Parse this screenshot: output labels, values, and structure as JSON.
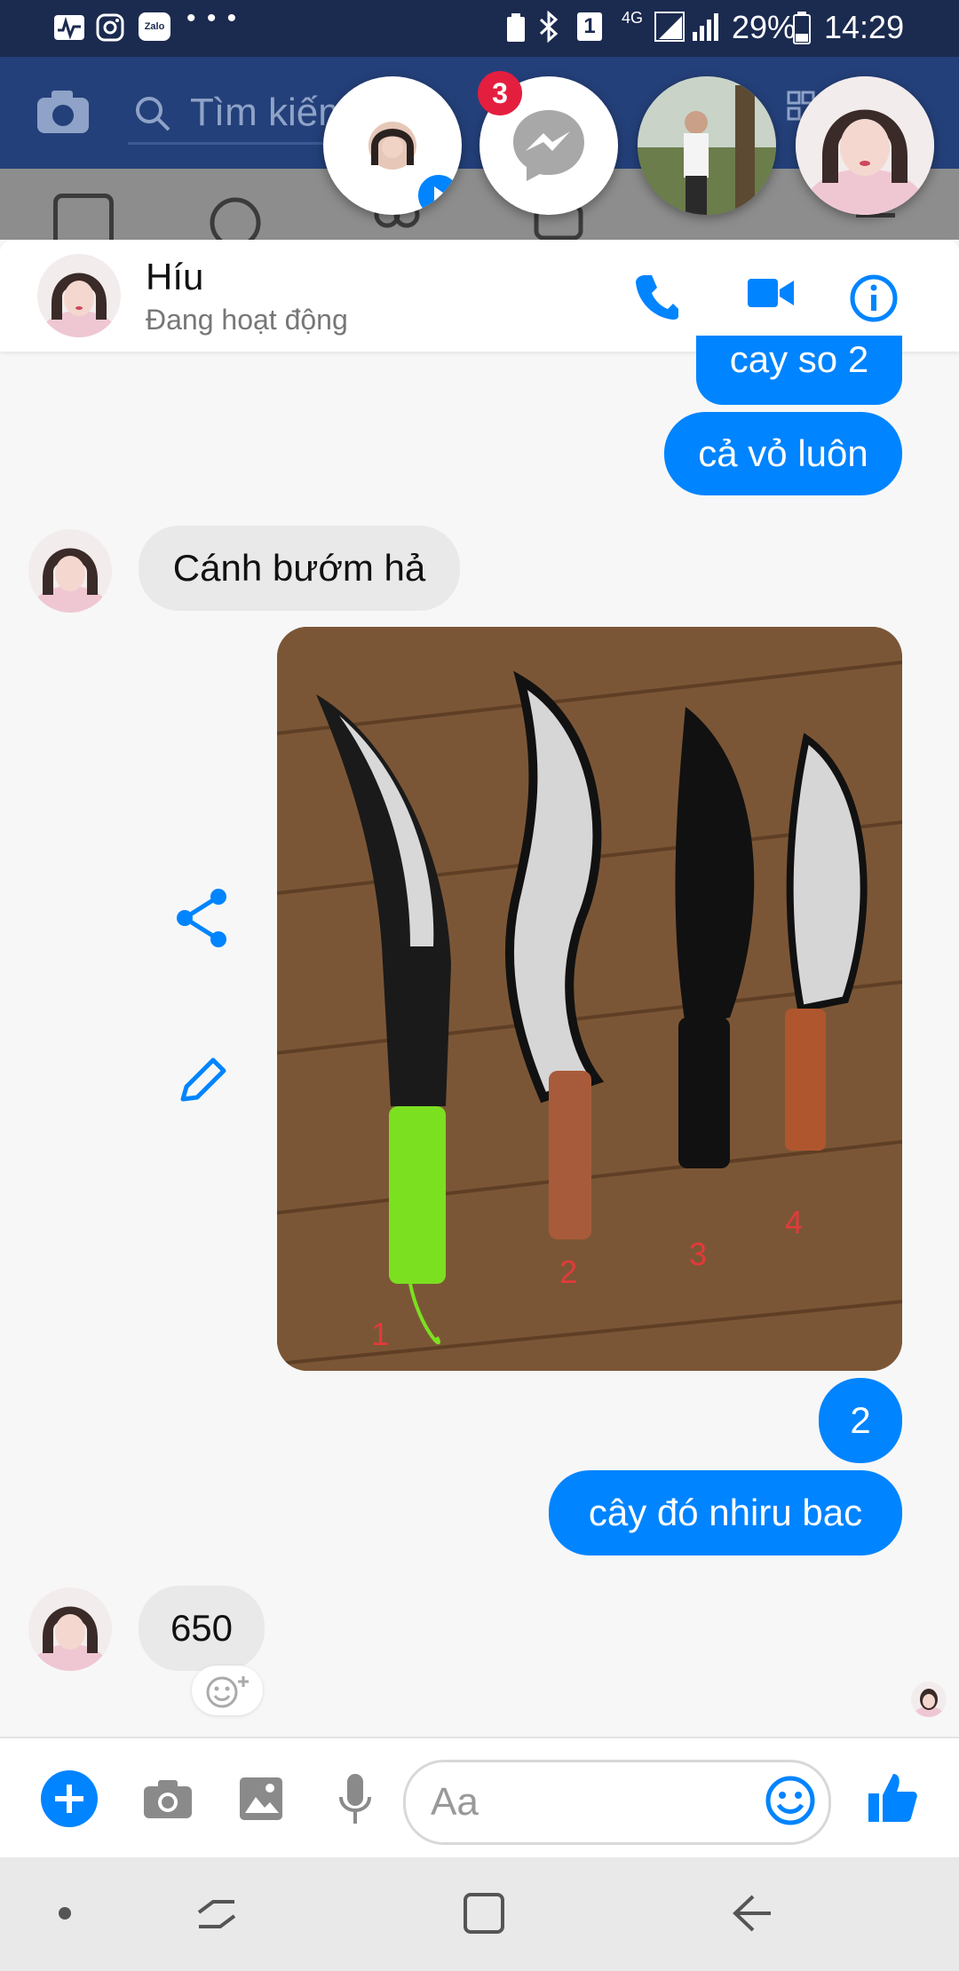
{
  "status_bar": {
    "left_icons": [
      "activity-icon",
      "instagram-icon",
      "zalo-icon"
    ],
    "zalo_text": "Zalo",
    "more": "• • •",
    "battery": "29%",
    "time": "14:29",
    "sim": "1",
    "network": "4G"
  },
  "facebook": {
    "search_placeholder": "Tìm kiếm"
  },
  "chat_heads": {
    "badge_count": "3"
  },
  "conversation": {
    "name": "Híu",
    "status": "Đang hoạt động"
  },
  "messages": {
    "out_1": "cay so 2",
    "out_2": "cả vỏ luôn",
    "in_1": "Cánh bướm hả",
    "image_labels": [
      "1",
      "2",
      "3",
      "4"
    ],
    "out_3": "2",
    "out_4": "cây đó nhiru bac",
    "in_2": "650"
  },
  "composer": {
    "placeholder": "Aa"
  },
  "colors": {
    "messenger_blue": "#0084ff",
    "facebook_blue": "#24407a",
    "status_bar": "#1b2a4f",
    "badge_red": "#e41e3f"
  }
}
